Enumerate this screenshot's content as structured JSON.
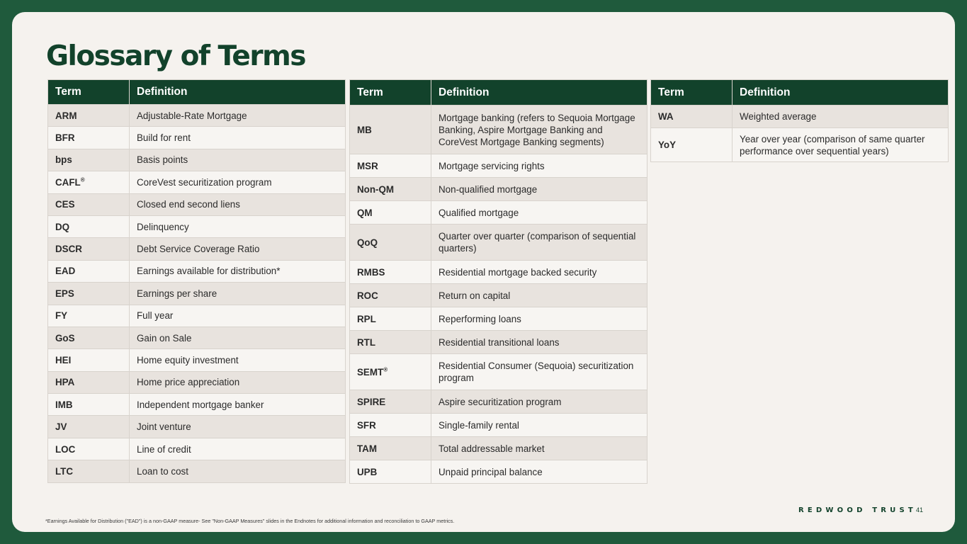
{
  "title": "Glossary of Terms",
  "header": {
    "term": "Term",
    "definition": "Definition"
  },
  "table1": [
    {
      "term": "ARM",
      "def": "Adjustable-Rate Mortgage"
    },
    {
      "term": "BFR",
      "def": "Build for rent"
    },
    {
      "term": "bps",
      "def": "Basis points"
    },
    {
      "term": "CAFL",
      "sup": "®",
      "def": "CoreVest securitization program"
    },
    {
      "term": "CES",
      "def": "Closed end second liens"
    },
    {
      "term": "DQ",
      "def": "Delinquency"
    },
    {
      "term": "DSCR",
      "def": "Debt Service Coverage Ratio"
    },
    {
      "term": "EAD",
      "def": "Earnings available for distribution*"
    },
    {
      "term": "EPS",
      "def": "Earnings per share"
    },
    {
      "term": "FY",
      "def": "Full year"
    },
    {
      "term": "GoS",
      "def": "Gain on Sale"
    },
    {
      "term": "HEI",
      "def": "Home equity investment"
    },
    {
      "term": "HPA",
      "def": "Home price appreciation"
    },
    {
      "term": "IMB",
      "def": "Independent mortgage banker"
    },
    {
      "term": "JV",
      "def": "Joint venture"
    },
    {
      "term": "LOC",
      "def": "Line of credit"
    },
    {
      "term": "LTC",
      "def": "Loan to cost"
    }
  ],
  "table2": [
    {
      "term": "MB",
      "def": "Mortgage banking (refers to Sequoia Mortgage Banking, Aspire Mortgage Banking and CoreVest Mortgage Banking segments)"
    },
    {
      "term": "MSR",
      "def": "Mortgage servicing rights"
    },
    {
      "term": "Non-QM",
      "def": "Non-qualified mortgage"
    },
    {
      "term": "QM",
      "def": "Qualified mortgage"
    },
    {
      "term": "QoQ",
      "def": "Quarter over quarter (comparison of sequential quarters)"
    },
    {
      "term": "RMBS",
      "def": "Residential mortgage backed security"
    },
    {
      "term": "ROC",
      "def": "Return on capital"
    },
    {
      "term": "RPL",
      "def": "Reperforming loans"
    },
    {
      "term": "RTL",
      "def": "Residential transitional loans"
    },
    {
      "term": "SEMT",
      "sup": "®",
      "def": "Residential Consumer (Sequoia) securitization program"
    },
    {
      "term": "SPIRE",
      "def": "Aspire securitization program"
    },
    {
      "term": "SFR",
      "def": "Single-family rental"
    },
    {
      "term": "TAM",
      "def": "Total addressable market"
    },
    {
      "term": "UPB",
      "def": "Unpaid principal balance"
    }
  ],
  "table3": [
    {
      "term": "WA",
      "def": "Weighted average"
    },
    {
      "term": "YoY",
      "def": "Year over year (comparison of same quarter performance over sequential years)"
    }
  ],
  "brand": "REDWOOD TRUST",
  "page_number": "41",
  "footnote": "*Earnings Available for Distribution (\"EAD\") is a non-GAAP measure- See \"Non-GAAP Measures\" slides in the Endnotes for additional information and reconciliation to GAAP metrics."
}
